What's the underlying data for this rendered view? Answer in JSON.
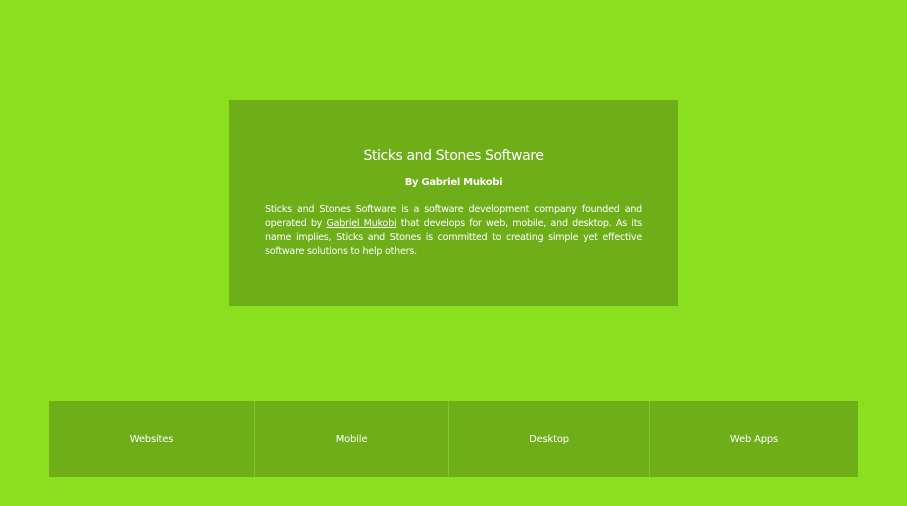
{
  "colors": {
    "page_background": "#8adf1e",
    "panel_background": "#6dae19",
    "text": "#ffffff"
  },
  "hero": {
    "title": "Sticks and Stones Software",
    "author": "By Gabriel Mukobi",
    "description_part1": "Sticks and Stones Software is a software development company founded and operated by ",
    "author_link": "Gabriel Mukobi",
    "description_part2": " that develops for web, mobile, and desktop. As its name implies, Sticks and Stones is committed to creating simple yet effective software solutions to help others."
  },
  "services": {
    "items": [
      {
        "label": "Websites"
      },
      {
        "label": "Mobile"
      },
      {
        "label": "Desktop"
      },
      {
        "label": "Web Apps"
      }
    ]
  }
}
